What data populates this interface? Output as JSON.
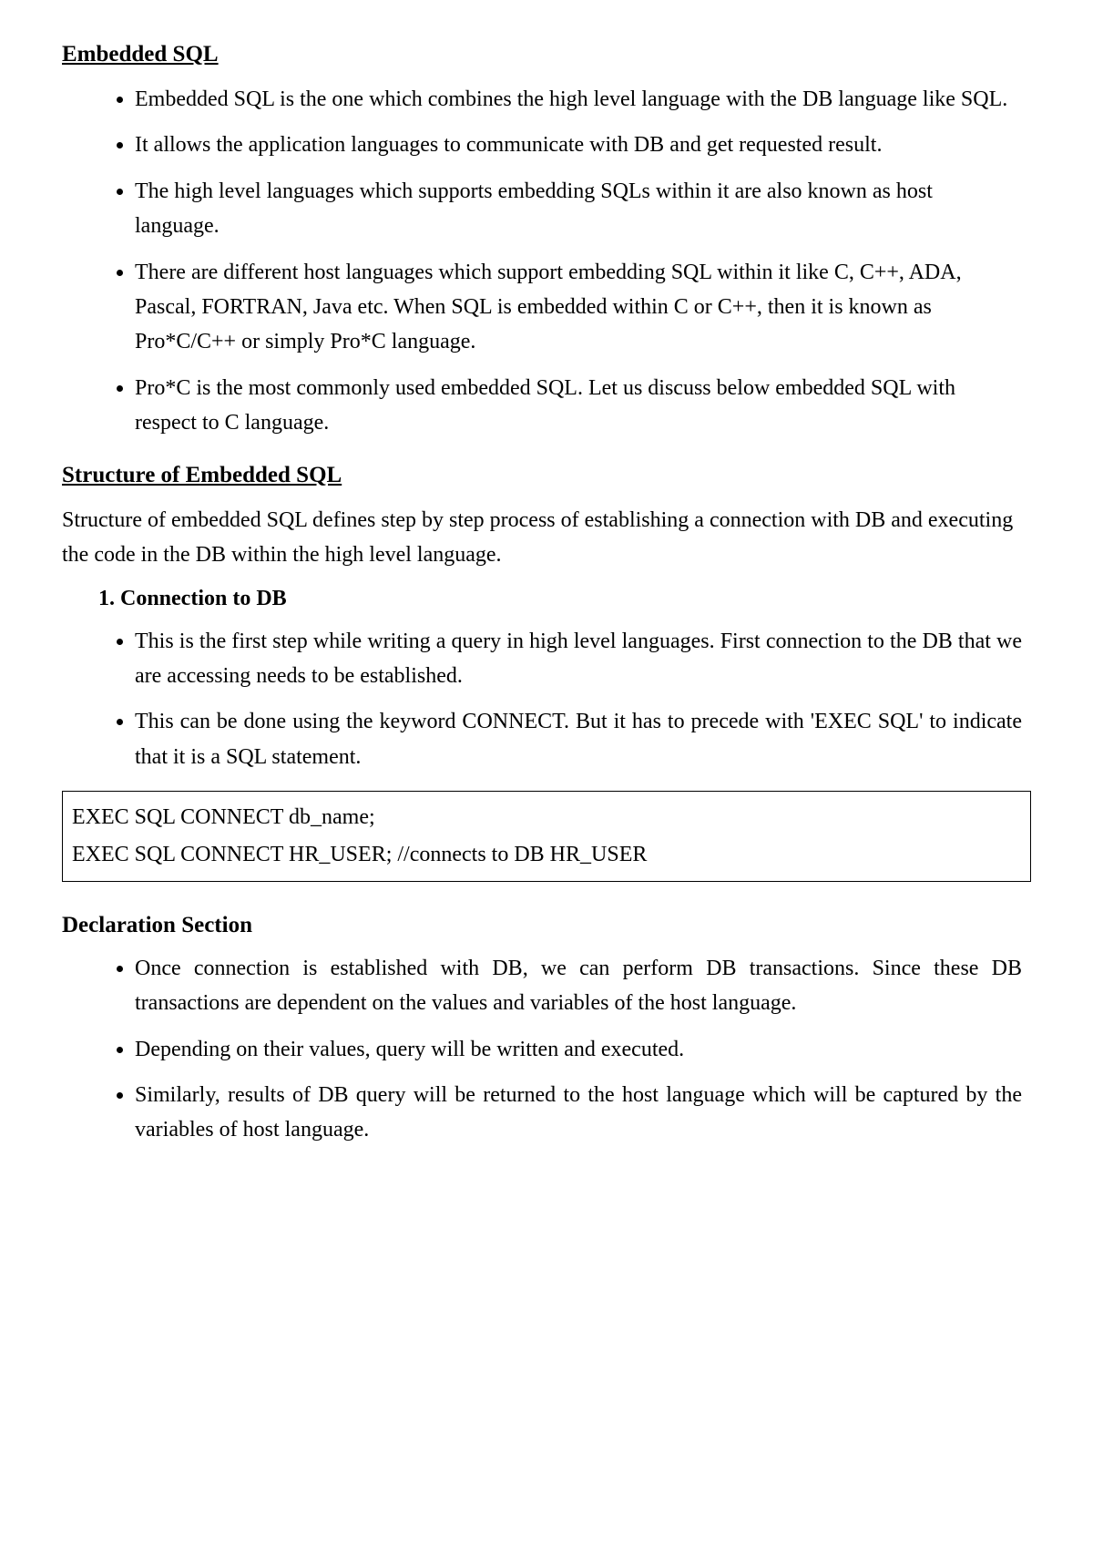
{
  "section1": {
    "title": "Embedded SQL",
    "bullets": [
      "Embedded SQL is the one which combines the high level language with the DB language like SQL.",
      " It allows the application languages to communicate with DB and get requested result.",
      "The high level languages which supports embedding SQLs within it are also known as host language.",
      "There are different host languages which support embedding SQL within it like C, C++, ADA, Pascal, FORTRAN, Java etc. When SQL is embedded within C or C++, then it is known as Pro*C/C++ or simply Pro*C language.",
      "Pro*C is the most commonly used embedded SQL. Let us discuss below embedded SQL with respect to C language."
    ]
  },
  "section2": {
    "title": "Structure of Embedded SQL",
    "intro": "Structure of embedded SQL defines step by step process of establishing a connection with DB and executing the code in the DB within the high level language.",
    "numbered": "1.  Connection to DB",
    "bullets": [
      "This is the first step while writing a query in high level languages. First connection to the DB that we are accessing needs to be established.",
      "This can be done using the keyword CONNECT. But it has to precede with 'EXEC SQL' to indicate that it is a SQL statement."
    ],
    "code": {
      "line1": "EXEC SQL CONNECT db_name;",
      "line2": "EXEC SQL CONNECT HR_USER; //connects to DB HR_USER"
    }
  },
  "section3": {
    "title": "Declaration Section",
    "bullets": [
      "Once connection is established with DB, we can perform DB transactions. Since these DB transactions are dependent on the values and variables of the host language.",
      "Depending on their values, query will be written and executed.",
      "Similarly, results of DB query will be returned to the host language which will be captured by the variables of host language."
    ]
  }
}
